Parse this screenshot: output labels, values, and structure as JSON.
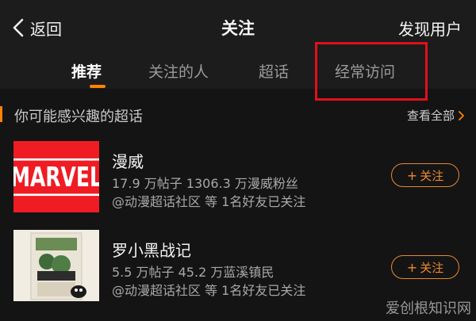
{
  "header": {
    "back_label": "返回",
    "title": "关注",
    "discover_label": "发现用户"
  },
  "tabs": [
    {
      "label": "推荐",
      "active": true
    },
    {
      "label": "关注的人",
      "active": false
    },
    {
      "label": "超话",
      "active": false
    },
    {
      "label": "经常访问",
      "active": false
    }
  ],
  "section": {
    "title": "你可能感兴趣的超话",
    "see_all_label": "查看全部"
  },
  "items": [
    {
      "name": "漫威",
      "stats": "17.9 万帖子  1306.3 万漫威粉丝",
      "friends": "@动漫超话社区 等 1名好友已关注",
      "follow_label": "关注",
      "thumb_text": "MARVEL"
    },
    {
      "name": "罗小黑战记",
      "stats": "5.5 万帖子  45.2 万蓝溪镇民",
      "friends": "@动漫超话社区 等 1名好友已关注",
      "follow_label": "关注"
    }
  ],
  "colors": {
    "accent": "#ff8200",
    "highlight_box": "#e0101a",
    "marvel_red": "#ef1c24"
  },
  "watermark": "爱创根知识网"
}
